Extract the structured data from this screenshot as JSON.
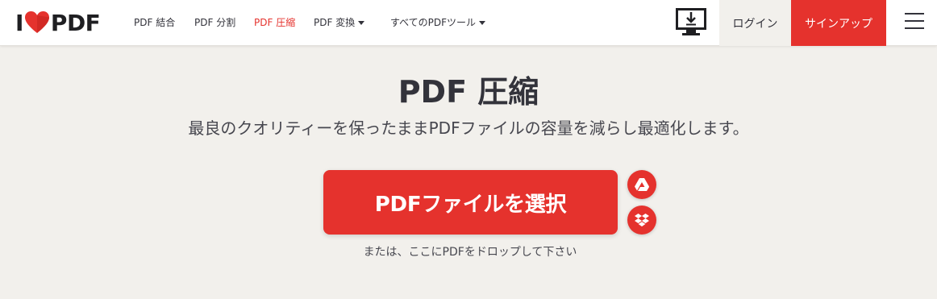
{
  "logo": {
    "left": "I",
    "right": "PDF"
  },
  "nav": {
    "items": [
      {
        "label": "PDF 結合"
      },
      {
        "label": "PDF 分割"
      },
      {
        "label": "PDF 圧縮"
      },
      {
        "label": "PDF 変換"
      },
      {
        "label": "すべてのPDFツール"
      }
    ],
    "active_index": 2
  },
  "header": {
    "login_label": "ログイン",
    "signup_label": "サインアップ"
  },
  "main": {
    "title": "PDF 圧縮",
    "subtitle": "最良のクオリティーを保ったままPDFファイルの容量を減らし最適化します。",
    "select_button_label": "PDFファイルを選択",
    "drop_hint": "または、ここにPDFをドロップして下さい"
  },
  "colors": {
    "brand_red": "#e5322d",
    "background": "#f2f0ec",
    "text": "#33333b"
  },
  "icons": [
    "heart-logo-icon",
    "desktop-download-icon",
    "hamburger-menu-icon",
    "google-drive-icon",
    "dropbox-icon"
  ]
}
